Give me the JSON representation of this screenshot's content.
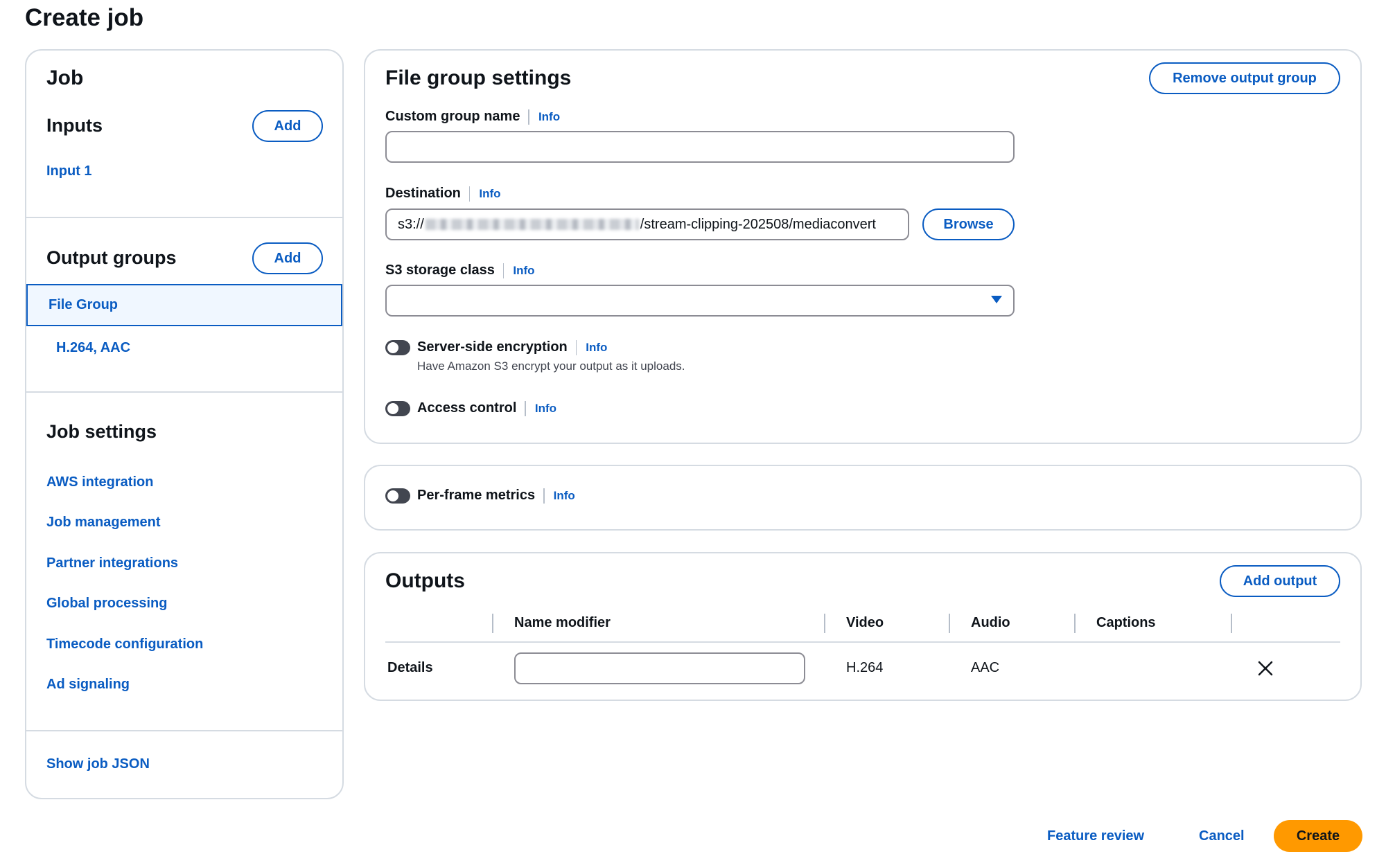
{
  "page": {
    "title": "Create job"
  },
  "nav": {
    "job_heading": "Job",
    "inputs": {
      "heading": "Inputs",
      "add_label": "Add",
      "items": [
        "Input 1"
      ]
    },
    "output_groups": {
      "heading": "Output groups",
      "add_label": "Add",
      "selected": "File Group",
      "sub_items": [
        "H.264, AAC"
      ]
    },
    "job_settings": {
      "heading": "Job settings",
      "items": [
        "AWS integration",
        "Job management",
        "Partner integrations",
        "Global processing",
        "Timecode configuration",
        "Ad signaling"
      ]
    },
    "show_json": "Show job JSON"
  },
  "file_group": {
    "heading": "File group settings",
    "remove_label": "Remove output group",
    "custom_group_name": {
      "label": "Custom group name",
      "info": "Info",
      "value": ""
    },
    "destination": {
      "label": "Destination",
      "info": "Info",
      "value_prefix": "s3://",
      "value_suffix": "/stream-clipping-202508/mediaconvert",
      "browse_label": "Browse"
    },
    "storage_class": {
      "label": "S3 storage class",
      "info": "Info",
      "value": ""
    },
    "encryption": {
      "label": "Server-side encryption",
      "info": "Info",
      "description": "Have Amazon S3 encrypt your output as it uploads.",
      "enabled": false
    },
    "access_control": {
      "label": "Access control",
      "info": "Info",
      "enabled": false
    }
  },
  "per_frame": {
    "label": "Per-frame metrics",
    "info": "Info",
    "enabled": false
  },
  "outputs": {
    "heading": "Outputs",
    "add_label": "Add output",
    "columns": [
      "Name modifier",
      "Video",
      "Audio",
      "Captions"
    ],
    "rows": [
      {
        "details": "Details",
        "name_modifier": "",
        "video": "H.264",
        "audio": "AAC",
        "captions": ""
      }
    ]
  },
  "footer": {
    "feature_review": "Feature review",
    "cancel": "Cancel",
    "create": "Create"
  },
  "colors": {
    "accent": "#0a5cc2",
    "primary_button": "#ff9900",
    "border": "#d5dbe2"
  }
}
